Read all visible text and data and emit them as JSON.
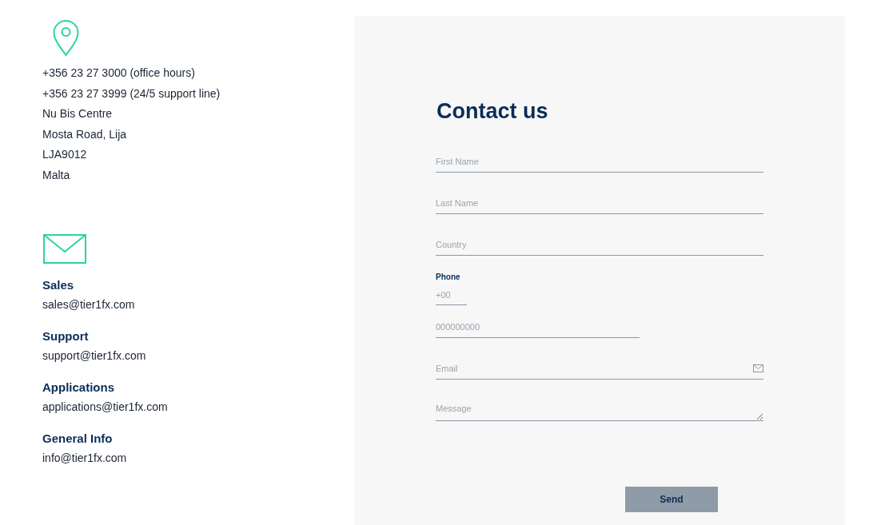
{
  "address": {
    "lines": [
      "+356 23 27 3000 (office hours)",
      "+356 23 27 3999 (24/5 support line)",
      "Nu Bis Centre",
      "Mosta Road, Lija",
      "LJA9012",
      "Malta"
    ]
  },
  "contacts": [
    {
      "title": "Sales",
      "email": "sales@tier1fx.com"
    },
    {
      "title": "Support",
      "email": "support@tier1fx.com"
    },
    {
      "title": "Applications",
      "email": "applications@tier1fx.com"
    },
    {
      "title": "General Info",
      "email": "info@tier1fx.com"
    }
  ],
  "form": {
    "title": "Contact us",
    "fields": [
      {
        "kind": "text",
        "placeholder": "First Name"
      },
      {
        "kind": "text",
        "placeholder": "Last Name"
      },
      {
        "kind": "text",
        "placeholder": "Country"
      },
      {
        "kind": "phone",
        "label": "Phone",
        "code_placeholder": "+00",
        "number_placeholder": "000000000"
      },
      {
        "kind": "email",
        "placeholder": "Email"
      },
      {
        "kind": "textarea",
        "placeholder": "Message"
      }
    ],
    "submit": "Send"
  }
}
